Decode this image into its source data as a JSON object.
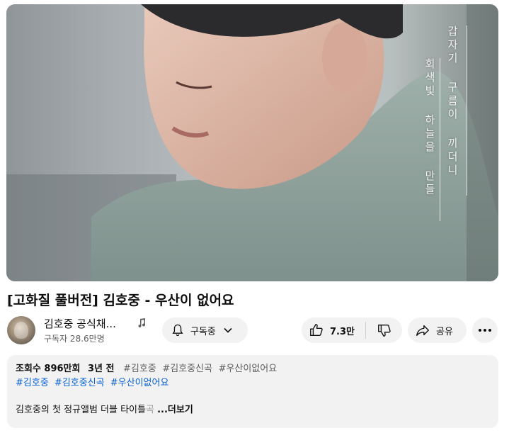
{
  "video": {
    "lyrics": {
      "line1": "갑자기 구름이 끼더니",
      "line2": "회색빛 하늘을 만들"
    }
  },
  "title": "[고화질 풀버전] 김호중 - 우산이 없어요",
  "channel": {
    "name": "김호중 공식채...",
    "subscribers": "구독자 28.6만명",
    "badge_icon": "music-note-icon"
  },
  "actions": {
    "subscribe_label": "구독중",
    "like_count": "7.3만",
    "share_label": "공유"
  },
  "description": {
    "views": "조회수 896만회",
    "age": "3년 전",
    "meta_tags": [
      "#김호중",
      "#김호중신곡",
      "#우산이없어요"
    ],
    "tags": [
      "#김호중",
      "#김호중신곡",
      "#우산이없어요"
    ],
    "body": "김호중의 첫 정규앨범 더블 타이틀",
    "body_fade": "곡",
    "more_label": "...더보기"
  },
  "colors": {
    "link": "#065fd4",
    "button_bg": "#f2f2f2",
    "secondary_text": "#606060"
  }
}
